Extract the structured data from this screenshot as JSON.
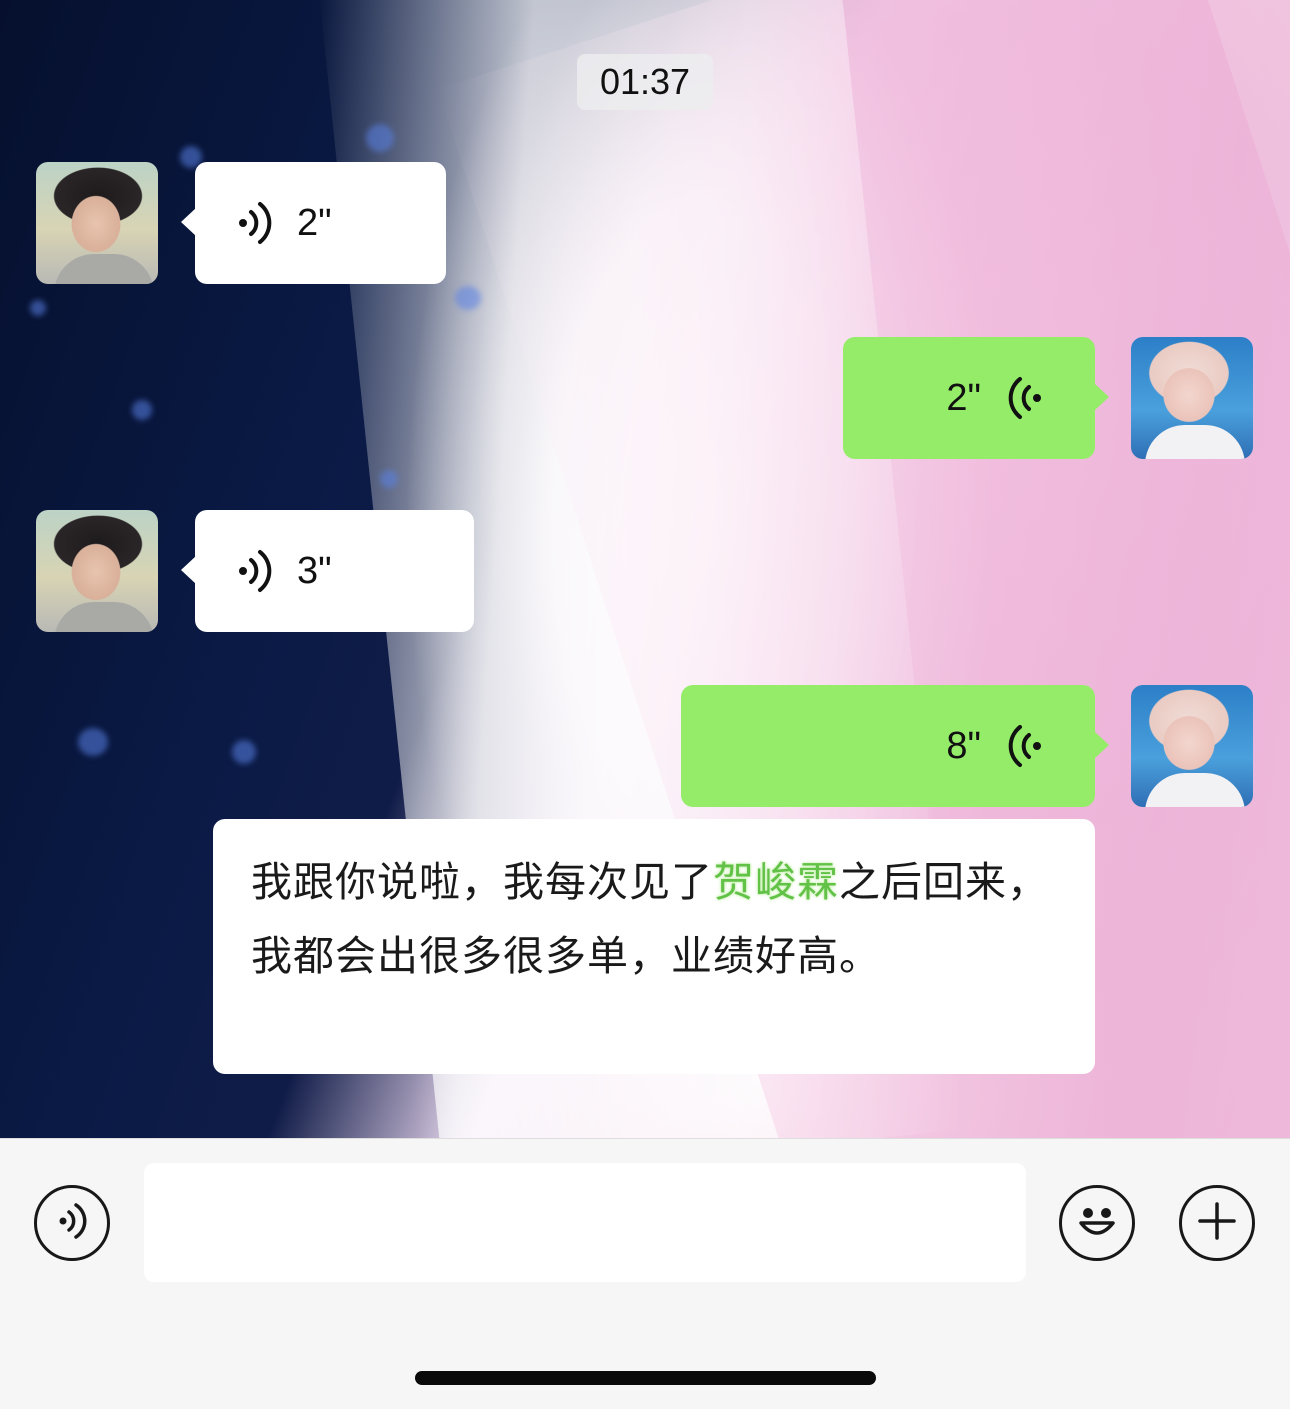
{
  "chat": {
    "timestamp": "01:37",
    "messages": [
      {
        "side": "in",
        "type": "voice",
        "duration": "2\"",
        "avatar": "contact-avatar"
      },
      {
        "side": "out",
        "type": "voice",
        "duration": "2\"",
        "avatar": "self-avatar"
      },
      {
        "side": "in",
        "type": "voice",
        "duration": "3\"",
        "avatar": "contact-avatar"
      },
      {
        "side": "out",
        "type": "voice",
        "duration": "8\"",
        "avatar": "self-avatar"
      }
    ],
    "transcript": {
      "before": "我跟你说啦，我每次见了",
      "highlight": "贺峻霖",
      "after": "之后回来，我都会出很多很多单，业绩好高。"
    }
  },
  "input_bar": {
    "voice_toggle_icon": "voice-icon",
    "text_value": "",
    "emoji_icon": "emoji-icon",
    "more_icon": "plus-icon"
  },
  "colors": {
    "outgoing_bubble": "#95ec69",
    "incoming_bubble": "#ffffff",
    "highlight_text": "#62c147",
    "toolbar_bg": "#f6f6f6"
  }
}
